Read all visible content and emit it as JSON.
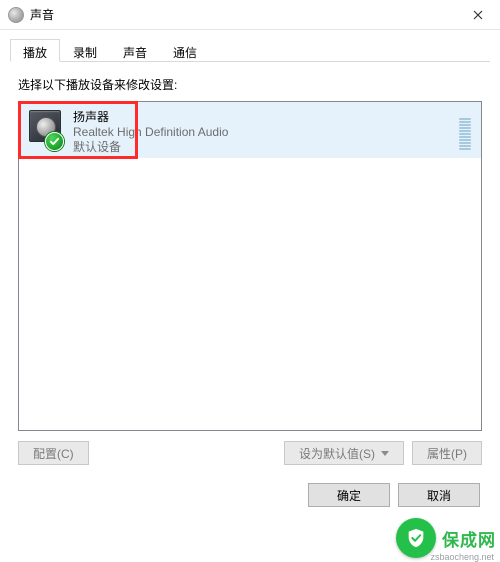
{
  "window": {
    "title": "声音",
    "close_label": "Close"
  },
  "tabs": {
    "playback": "播放",
    "recording": "录制",
    "sounds": "声音",
    "communications": "通信"
  },
  "instruction": "选择以下播放设备来修改设置:",
  "devices": [
    {
      "name": "扬声器",
      "driver": "Realtek High Definition Audio",
      "status": "默认设备",
      "is_default": true
    }
  ],
  "buttons": {
    "configure": "配置(C)",
    "set_default": "设为默认值(S)",
    "properties": "属性(P)",
    "ok": "确定",
    "cancel": "取消"
  },
  "watermark": {
    "name": "保成网",
    "domain": "zsbaocheng.net"
  }
}
